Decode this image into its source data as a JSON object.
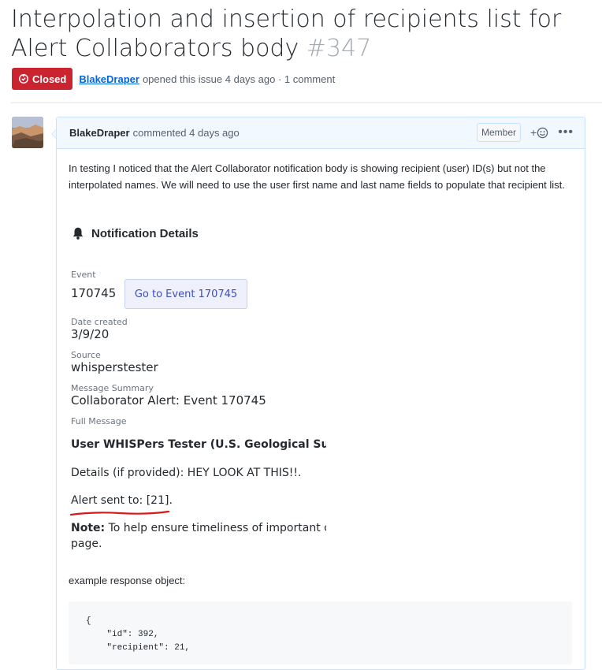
{
  "issue": {
    "title": "Interpolation and insertion of recipients list for Alert Collaborators body",
    "number": "#347",
    "state": "Closed",
    "author": "BlakeDraper",
    "opened_text": "opened this issue 4 days ago · 1 comment"
  },
  "comment": {
    "author": "BlakeDraper",
    "time": "commented 4 days ago",
    "role_badge": "Member",
    "reaction_label": "+",
    "more_label": "•••",
    "body": "In testing I noticed that the Alert Collaborator notification body is showing recipient (user) ID(s) but not the interpolated names. We will need to use the user first name and last name fields to populate that recipient list."
  },
  "notification": {
    "heading": "Notification Details",
    "event_label": "Event",
    "event_value": "170745",
    "event_button": "Go to Event 170745",
    "date_label": "Date created",
    "date_value": "3/9/20",
    "source_label": "Source",
    "source_value": "whisperstester",
    "summary_label": "Message Summary",
    "summary_value": "Collaborator Alert: Event 170745",
    "full_label": "Full Message",
    "full_line1": "User WHISPers Tester (U.S. Geological Survey",
    "full_line2": "Details (if provided): HEY LOOK AT THIS!!.",
    "full_line3": "Alert sent to: [21].",
    "note_bold": "Note:",
    "note_rest": " To help ensure timeliness of important co",
    "note_line2": "page."
  },
  "example": {
    "label": "example response object:",
    "code_lines": [
      "{",
      "    \"id\": 392,",
      "    \"recipient\": 21,"
    ]
  },
  "colors": {
    "closed_badge": "#cb2431",
    "link": "#0366d6",
    "comment_header_bg": "#f1f8ff",
    "annotation_red": "#d7191c"
  }
}
